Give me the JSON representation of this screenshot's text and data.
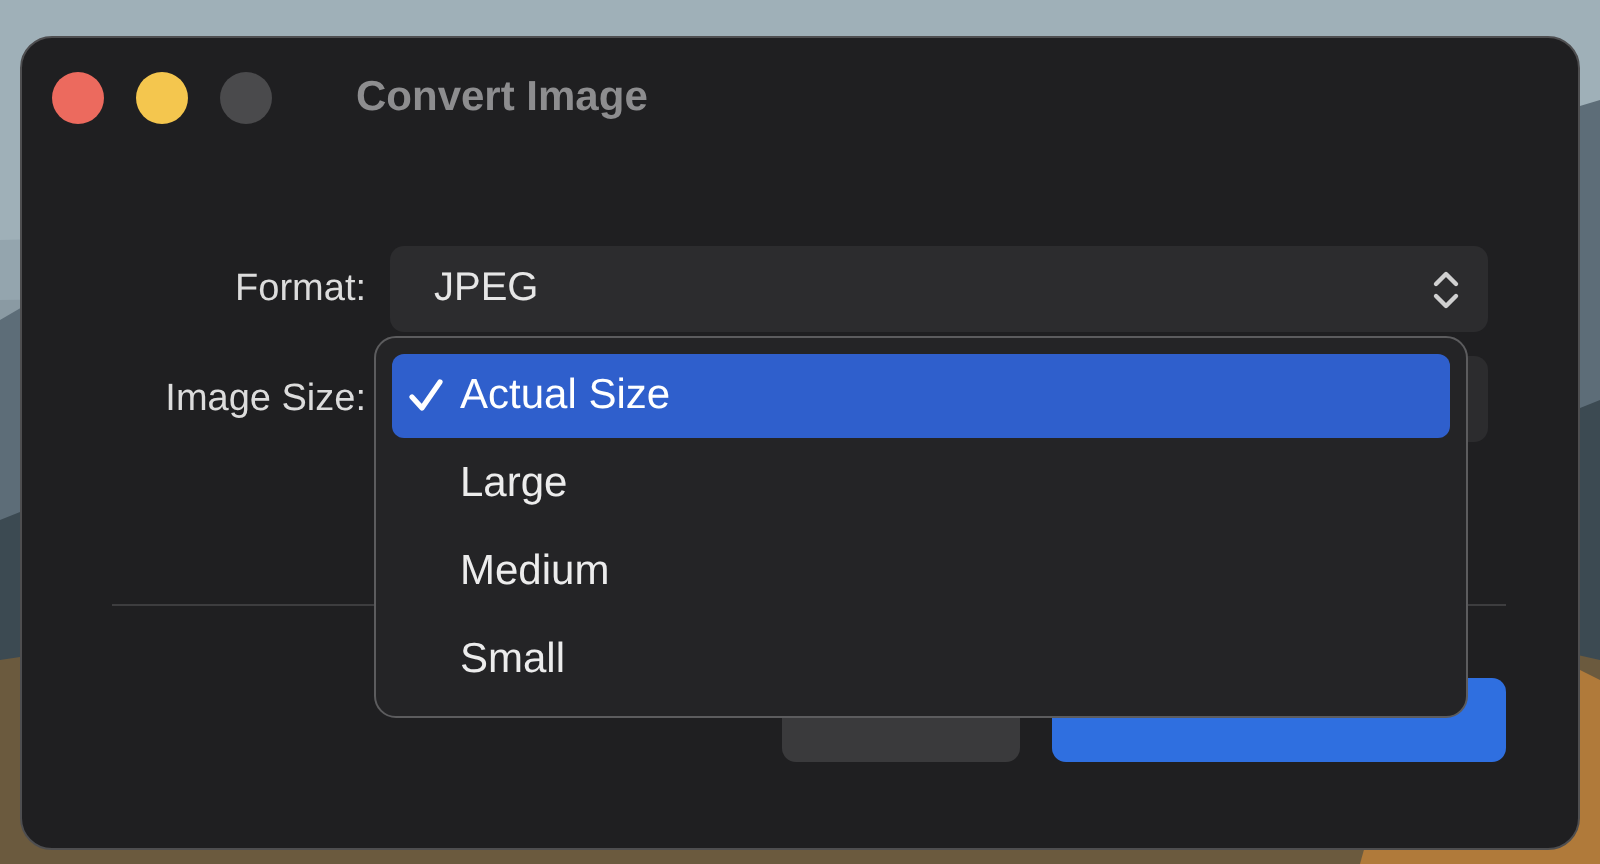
{
  "window": {
    "title": "Convert Image"
  },
  "form": {
    "format": {
      "label": "Format:",
      "value": "JPEG"
    },
    "image_size": {
      "label": "Image Size:"
    }
  },
  "menu": {
    "items": [
      {
        "label": "Actual Size",
        "selected": true
      },
      {
        "label": "Large",
        "selected": false
      },
      {
        "label": "Medium",
        "selected": false
      },
      {
        "label": "Small",
        "selected": false
      }
    ]
  },
  "buttons": [
    {
      "kind": "secondary"
    },
    {
      "kind": "primary"
    }
  ]
}
